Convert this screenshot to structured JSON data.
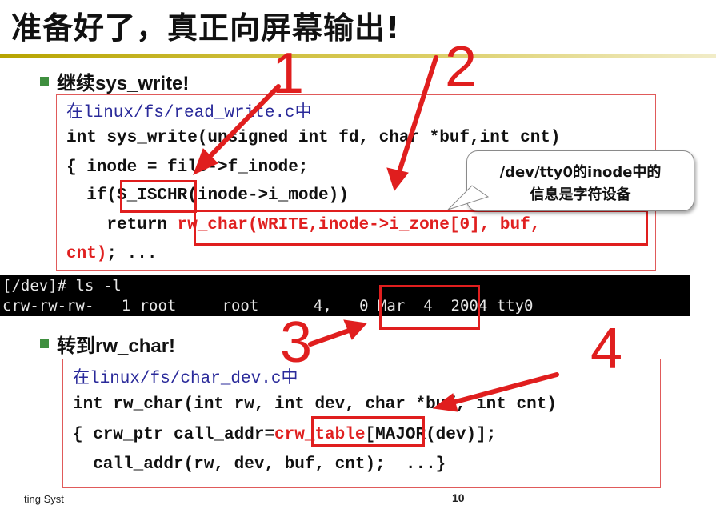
{
  "slide": {
    "title": "准备好了，真正向屏幕输出!",
    "bullet1": "继续sys_write!",
    "bullet2": "转到rw_char!",
    "footer_left": "ting Syst",
    "page_number": "10"
  },
  "code1": {
    "path_prefix": "在",
    "path": "linux/fs/read_write.c",
    "path_suffix": "中",
    "line1": "int sys_write(unsigned int fd, char *buf,int cnt)",
    "line2": "{ inode = file->f_inode;",
    "line3_a": "  if(",
    "line3_b": "S_ISCHR",
    "line3_c": "(inode->i_mode))",
    "line4_a": "    return ",
    "line4_b": "rw_char(WRITE,inode->i_zone[0], buf,",
    "line5_a": "cnt)",
    "line5_b": "; ..."
  },
  "terminal": {
    "line1": "[/dev]# ls -l",
    "line2": "crw-rw-rw-   1 root     root      4,   0 Mar  4  2004 tty0"
  },
  "code2": {
    "path_prefix": "在",
    "path": "linux/fs/char_dev.c",
    "path_suffix": "中",
    "line1": "int rw_char(int rw, int dev, char *buf, int cnt)",
    "line2_a": "{ crw_ptr call_addr=",
    "line2_b": "crw_table",
    "line2_c": "[MAJOR(dev)];",
    "line3": "  call_addr(rw, dev, buf, cnt);  ...}"
  },
  "callout": {
    "line1": "/dev/tty0的inode中的",
    "line2": "信息是字符设备"
  },
  "annotations": {
    "n1": "1",
    "n2": "2",
    "n3": "3",
    "n4": "4"
  },
  "colors": {
    "highlight": "#e01e1e",
    "terminal_bg": "#000000"
  }
}
